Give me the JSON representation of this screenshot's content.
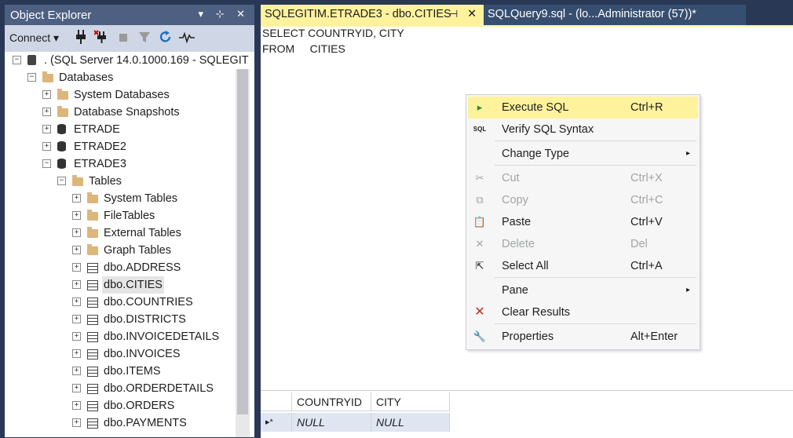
{
  "object_explorer": {
    "title": "Object Explorer",
    "title_buttons": "▾ ⊹ ✕",
    "toolbar": {
      "connect_label": "Connect",
      "connect_arrow": "▾"
    },
    "tree": [
      {
        "label": ". (SQL Server 14.0.1000.169 - SQLEGIT",
        "icon": "server-icon",
        "expander": "−"
      },
      {
        "label": "Databases",
        "icon": "folder-icon",
        "expander": "−"
      },
      {
        "label": "System Databases",
        "icon": "folder-icon",
        "expander": "+"
      },
      {
        "label": "Database Snapshots",
        "icon": "folder-icon",
        "expander": "+"
      },
      {
        "label": "ETRADE",
        "icon": "database-icon",
        "expander": "+"
      },
      {
        "label": "ETRADE2",
        "icon": "database-icon",
        "expander": "+"
      },
      {
        "label": "ETRADE3",
        "icon": "database-icon",
        "expander": "−"
      },
      {
        "label": "Tables",
        "icon": "folder-icon",
        "expander": "−"
      },
      {
        "label": "System Tables",
        "icon": "folder-icon",
        "expander": "+"
      },
      {
        "label": "FileTables",
        "icon": "folder-icon",
        "expander": "+"
      },
      {
        "label": "External Tables",
        "icon": "folder-icon",
        "expander": "+"
      },
      {
        "label": "Graph Tables",
        "icon": "folder-icon",
        "expander": "+"
      },
      {
        "label": "dbo.ADDRESS",
        "icon": "table-icon",
        "expander": "+"
      },
      {
        "label": "dbo.CITIES",
        "icon": "table-icon",
        "expander": "+",
        "selected": true
      },
      {
        "label": "dbo.COUNTRIES",
        "icon": "table-icon",
        "expander": "+"
      },
      {
        "label": "dbo.DISTRICTS",
        "icon": "table-icon",
        "expander": "+"
      },
      {
        "label": "dbo.INVOICEDETAILS",
        "icon": "table-icon",
        "expander": "+"
      },
      {
        "label": "dbo.INVOICES",
        "icon": "table-icon",
        "expander": "+"
      },
      {
        "label": "dbo.ITEMS",
        "icon": "table-icon",
        "expander": "+"
      },
      {
        "label": "dbo.ORDERDETAILS",
        "icon": "table-icon",
        "expander": "+"
      },
      {
        "label": "dbo.ORDERS",
        "icon": "table-icon",
        "expander": "+"
      },
      {
        "label": "dbo.PAYMENTS",
        "icon": "table-icon",
        "expander": "+"
      }
    ]
  },
  "tabs": [
    {
      "label": "SQLEGITIM.ETRADE3 - dbo.CITIES",
      "pin": "⊣",
      "close": "✕",
      "active": true
    },
    {
      "label": "SQLQuery9.sql - (lo...Administrator (57))*",
      "active": false
    }
  ],
  "editor": {
    "lines": [
      "SELECT COUNTRYID, CITY",
      "FROM     CITIES"
    ]
  },
  "results": {
    "columns": [
      "COUNTRYID",
      "CITY"
    ],
    "rows": [
      {
        "marker": "▸*",
        "values": [
          "NULL",
          "NULL"
        ]
      }
    ]
  },
  "context_menu": {
    "items": [
      {
        "label": "Execute SQL",
        "shortcut": "Ctrl+R",
        "icon": "execute-icon",
        "glyph": "▸",
        "highlighted": true
      },
      {
        "label": "Verify SQL Syntax",
        "shortcut": "",
        "icon": "sql-icon",
        "glyph": "SQL"
      },
      {
        "label": "Change Type",
        "shortcut": "",
        "icon": "",
        "glyph": "",
        "submenu": "▸"
      },
      {
        "label": "Cut",
        "shortcut": "Ctrl+X",
        "icon": "cut-icon",
        "glyph": "✂",
        "disabled": true
      },
      {
        "label": "Copy",
        "shortcut": "Ctrl+C",
        "icon": "copy-icon",
        "glyph": "⧉",
        "disabled": true
      },
      {
        "label": "Paste",
        "shortcut": "Ctrl+V",
        "icon": "paste-icon",
        "glyph": "📋"
      },
      {
        "label": "Delete",
        "shortcut": "Del",
        "icon": "delete-icon",
        "glyph": "✕",
        "disabled": true
      },
      {
        "label": "Select All",
        "shortcut": "Ctrl+A",
        "icon": "select-all-icon",
        "glyph": "⇱"
      },
      {
        "label": "Pane",
        "shortcut": "",
        "icon": "",
        "glyph": "",
        "submenu": "▸"
      },
      {
        "label": "Clear Results",
        "shortcut": "",
        "icon": "clear-results-icon",
        "glyph": "✕"
      },
      {
        "label": "Properties",
        "shortcut": "Alt+Enter",
        "icon": "wrench-icon",
        "glyph": "🔧"
      }
    ]
  }
}
